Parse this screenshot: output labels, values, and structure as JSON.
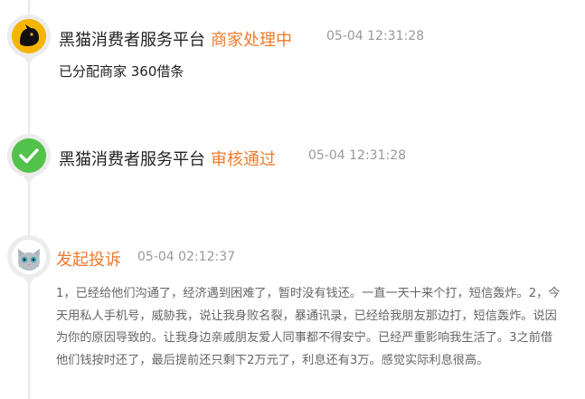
{
  "events": [
    {
      "actor": "黑猫消费者服务平台",
      "status": "商家处理中",
      "time": "05-04 12:31:28",
      "content": "已分配商家 360借条"
    },
    {
      "actor": "黑猫消费者服务平台",
      "status": "审核通过",
      "time": "05-04 12:31:28"
    },
    {
      "status": "发起投诉",
      "time": "05-04 02:12:37",
      "content": "1，已经给他们沟通了，经济遇到困难了，暂时没有钱还。一直一天十来个打，短信轰炸。2，今天用私人手机号，威胁我，说让我身败名裂，暴通讯录，已经给我朋友那边打，短信轰炸。说因为你的原因导致的。让我身边亲戚朋友爱人同事都不得安宁。已经严重影响我生活了。3之前借他们钱按时还了，最后提前还只剩下2万元了，利息还有3万。感觉实际利息很高。"
    }
  ],
  "colors": {
    "accent": "#f07a2a",
    "check_green": "#52c24a"
  }
}
